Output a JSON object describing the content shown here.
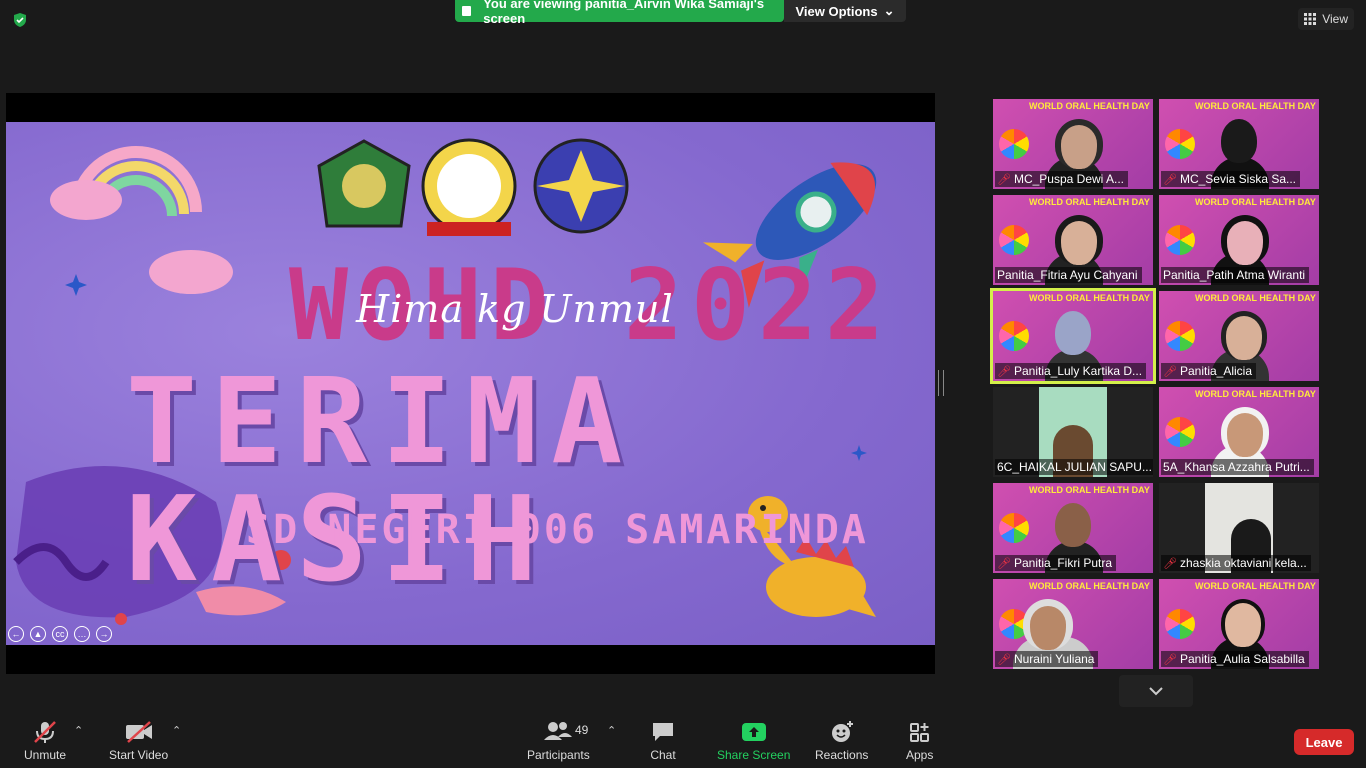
{
  "top": {
    "banner_text": "You are viewing panitia_Airvin Wika Samiaji's screen",
    "view_options_label": "View Options",
    "view_label": "View"
  },
  "slide": {
    "script_text": "Hima kg Unmul",
    "event_text": "WOHD 2022",
    "thanks_text": "TERIMA KASIH",
    "school_text": "SD NEGERI 006 SAMARINDA"
  },
  "gallery": {
    "poster_header": "WORLD ORAL HEALTH DAY",
    "participants": [
      {
        "name": "MC_Puspa Dewi A...",
        "muted": true
      },
      {
        "name": "MC_Sevia Siska Sa...",
        "muted": true
      },
      {
        "name": "Panitia_Fitria Ayu Cahyani",
        "muted": false
      },
      {
        "name": "Panitia_Patih Atma Wiranti",
        "muted": false
      },
      {
        "name": "Panitia_Luly Kartika D...",
        "muted": true
      },
      {
        "name": "Panitia_Alicia",
        "muted": true
      },
      {
        "name": "6C_HAIKAL JULIAN SAPU...",
        "muted": false
      },
      {
        "name": "5A_Khansa Azzahra Putri...",
        "muted": false
      },
      {
        "name": "Panitia_Fikri Putra",
        "muted": true
      },
      {
        "name": "zhaskia oktaviani kela...",
        "muted": true
      },
      {
        "name": "Nuraini Yuliana",
        "muted": true
      },
      {
        "name": "Panitia_Aulia Salsabilla",
        "muted": true
      }
    ]
  },
  "toolbar": {
    "unmute": "Unmute",
    "start_video": "Start Video",
    "participants": "Participants",
    "participants_count": "49",
    "chat": "Chat",
    "share_screen": "Share Screen",
    "reactions": "Reactions",
    "apps": "Apps",
    "leave": "Leave"
  },
  "colors": {
    "share_green": "#23a94b",
    "leave_red": "#d62a2a",
    "active_speaker": "#d4f04a"
  }
}
